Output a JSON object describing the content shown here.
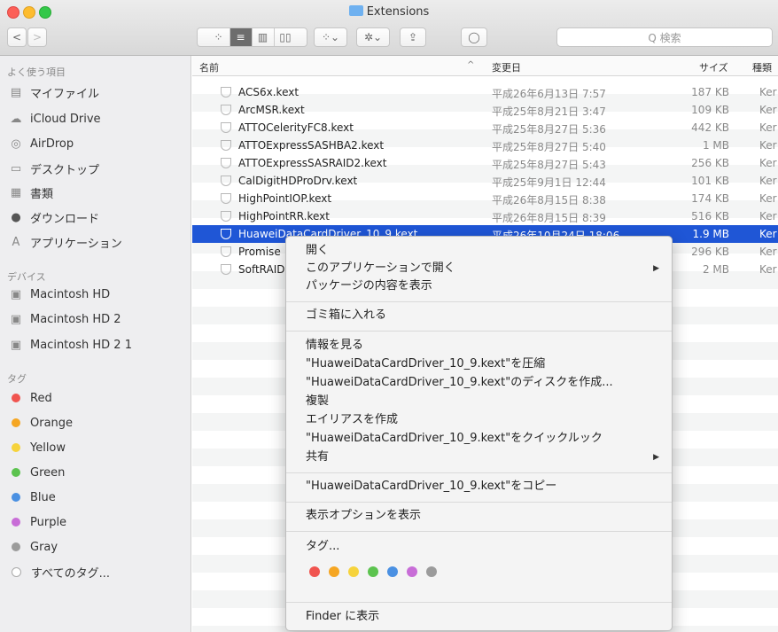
{
  "window": {
    "title": "Extensions"
  },
  "toolbar": {
    "view_icons": [
      "⁘",
      "≡",
      "▥",
      "▯▯",
      "⁘⌄"
    ],
    "action_label": "✲⌄",
    "share_label": "⇪",
    "tag_label": "◯",
    "search_placeholder": "Q 検索"
  },
  "sidebar": {
    "favorites_header": "よく使う項目",
    "favorites": [
      {
        "label": "マイファイル",
        "icon": "all-files-icon"
      },
      {
        "label": "iCloud Drive",
        "icon": "cloud-icon"
      },
      {
        "label": "AirDrop",
        "icon": "airdrop-icon"
      },
      {
        "label": "デスクトップ",
        "icon": "desktop-icon"
      },
      {
        "label": "書類",
        "icon": "documents-icon"
      },
      {
        "label": "ダウンロード",
        "icon": "download-icon"
      },
      {
        "label": "アプリケーション",
        "icon": "applications-icon"
      }
    ],
    "devices_header": "デバイス",
    "devices": [
      {
        "label": "Macintosh HD",
        "icon": "disk-icon"
      },
      {
        "label": "Macintosh HD 2",
        "icon": "disk-icon"
      },
      {
        "label": "Macintosh HD 2 1",
        "icon": "disk-icon"
      }
    ],
    "tags_header": "タグ",
    "tags": [
      {
        "label": "Red",
        "color": "#f0544f"
      },
      {
        "label": "Orange",
        "color": "#f5a623"
      },
      {
        "label": "Yellow",
        "color": "#f6d33c"
      },
      {
        "label": "Green",
        "color": "#5cc34f"
      },
      {
        "label": "Blue",
        "color": "#4a90e2"
      },
      {
        "label": "Purple",
        "color": "#c86dd7"
      },
      {
        "label": "Gray",
        "color": "#9b9b9b"
      },
      {
        "label": "すべてのタグ...",
        "color": ""
      }
    ]
  },
  "columns": {
    "name": "名前",
    "sort_indicator": "^",
    "date": "変更日",
    "size": "サイズ",
    "kind": "種類"
  },
  "files": [
    {
      "name": "ACS6x.kext",
      "date": "平成26年6月13日 7:57",
      "size": "187 KB",
      "kind": "Ker"
    },
    {
      "name": "ArcMSR.kext",
      "date": "平成25年8月21日 3:47",
      "size": "109 KB",
      "kind": "Ker"
    },
    {
      "name": "ATTOCelerityFC8.kext",
      "date": "平成25年8月27日 5:36",
      "size": "442 KB",
      "kind": "Ker"
    },
    {
      "name": "ATTOExpressSASHBA2.kext",
      "date": "平成25年8月27日 5:40",
      "size": "1 MB",
      "kind": "Ker"
    },
    {
      "name": "ATTOExpressSASRAID2.kext",
      "date": "平成25年8月27日 5:43",
      "size": "256 KB",
      "kind": "Ker"
    },
    {
      "name": "CalDigitHDProDrv.kext",
      "date": "平成25年9月1日 12:44",
      "size": "101 KB",
      "kind": "Ker"
    },
    {
      "name": "HighPointIOP.kext",
      "date": "平成26年8月15日 8:38",
      "size": "174 KB",
      "kind": "Ker"
    },
    {
      "name": "HighPointRR.kext",
      "date": "平成26年8月15日 8:39",
      "size": "516 KB",
      "kind": "Ker"
    },
    {
      "name": "HuaweiDataCardDriver_10_9.kext",
      "date": "平成26年10月24日 18:06",
      "size": "1.9 MB",
      "kind": "Ker",
      "selected": true
    },
    {
      "name": "Promise",
      "date": "",
      "size": "296 KB",
      "kind": "Ker"
    },
    {
      "name": "SoftRAID",
      "date": "",
      "size": "2 MB",
      "kind": "Ker"
    }
  ],
  "context_menu": {
    "open": "開く",
    "open_with": "このアプリケーションで開く",
    "show_package": "パッケージの内容を表示",
    "trash": "ゴミ箱に入れる",
    "get_info": "情報を見る",
    "compress": "\"HuaweiDataCardDriver_10_9.kext\"を圧縮",
    "burn": "\"HuaweiDataCardDriver_10_9.kext\"のディスクを作成...",
    "duplicate": "複製",
    "make_alias": "エイリアスを作成",
    "quicklook": "\"HuaweiDataCardDriver_10_9.kext\"をクイックルック",
    "share": "共有",
    "copy": "\"HuaweiDataCardDriver_10_9.kext\"をコピー",
    "view_options": "表示オプションを表示",
    "tags": "タグ...",
    "tag_colors": [
      "#f0544f",
      "#f5a623",
      "#f6d33c",
      "#5cc34f",
      "#4a90e2",
      "#c86dd7",
      "#9b9b9b"
    ],
    "show_in_finder": "Finder に表示",
    "submenu_arrow": "▶"
  }
}
